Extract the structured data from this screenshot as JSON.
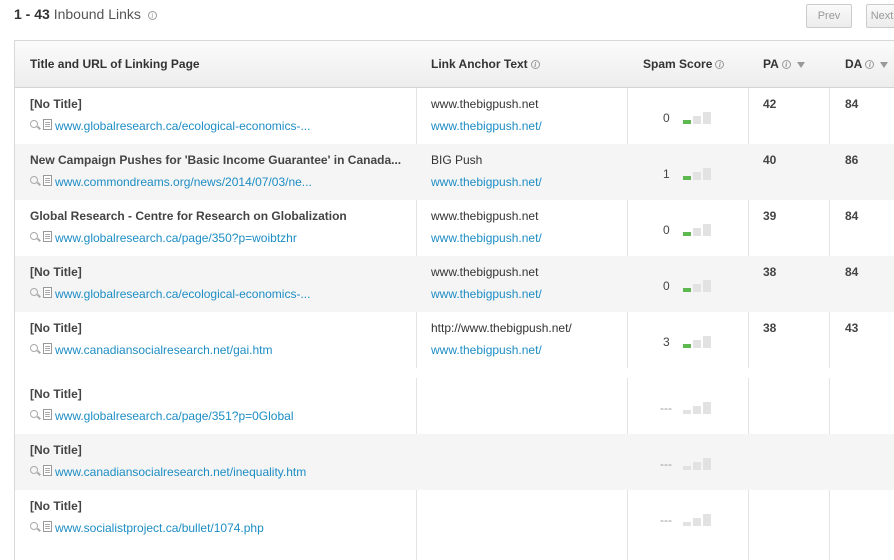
{
  "summary": {
    "range": "1 - 43",
    "label": "Inbound Links"
  },
  "pager": {
    "prev": "Prev",
    "next": "Next"
  },
  "columns": {
    "title_url": "Title and URL of Linking Page",
    "anchor": "Link Anchor Text",
    "spam": "Spam Score",
    "pa": "PA",
    "da": "DA"
  },
  "rows": [
    {
      "title": "[No Title]",
      "url": "www.globalresearch.ca/ecological-economics-...",
      "anchor_text": "www.thebigpush.net",
      "anchor_url": "www.thebigpush.net/",
      "spam": "0",
      "pa": "42",
      "da": "84"
    },
    {
      "title": "New Campaign Pushes for 'Basic Income Guarantee' in Canada...",
      "url": "www.commondreams.org/news/2014/07/03/ne...",
      "anchor_text": "BIG Push",
      "anchor_url": "www.thebigpush.net/",
      "spam": "1",
      "pa": "40",
      "da": "86"
    },
    {
      "title": "Global Research - Centre for Research on Globalization",
      "url": "www.globalresearch.ca/page/350?p=woibtzhr",
      "anchor_text": "www.thebigpush.net",
      "anchor_url": "www.thebigpush.net/",
      "spam": "0",
      "pa": "39",
      "da": "84"
    },
    {
      "title": "[No Title]",
      "url": "www.globalresearch.ca/ecological-economics-...",
      "anchor_text": "www.thebigpush.net",
      "anchor_url": "www.thebigpush.net/",
      "spam": "0",
      "pa": "38",
      "da": "84"
    },
    {
      "title": "[No Title]",
      "url": "www.canadiansocialresearch.net/gai.htm",
      "anchor_text": "http://www.thebigpush.net/",
      "anchor_url": "www.thebigpush.net/",
      "spam": "3",
      "pa": "38",
      "da": "43"
    },
    {
      "title": "[No Title]",
      "url": "www.globalresearch.ca/page/351?p=0Global",
      "spam": "---"
    },
    {
      "title": "[No Title]",
      "url": "www.canadiansocialresearch.net/inequality.htm",
      "spam": "---"
    },
    {
      "title": "[No Title]",
      "url": "www.socialistproject.ca/bullet/1074.php",
      "spam": "---"
    }
  ]
}
